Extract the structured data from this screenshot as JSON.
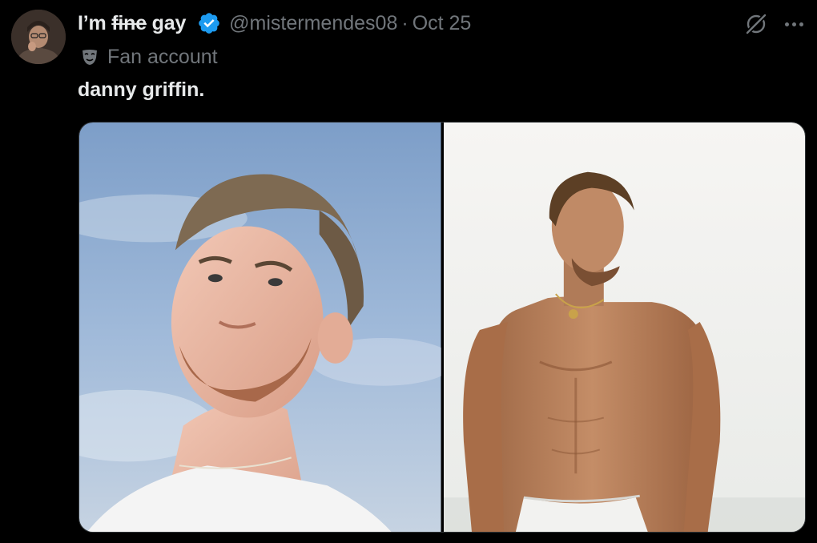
{
  "tweet": {
    "author": {
      "name_struck": "fine",
      "name_prefix": "I’m ",
      "name_suffix": " gay",
      "handle": "@mistermendes08",
      "verified": true
    },
    "separator": "·",
    "date": "Oct 25",
    "account_label": "Fan account",
    "text": "danny griffin.",
    "media": [
      {
        "icon": "photo-selfie",
        "description_color": "#8ea9cf"
      },
      {
        "icon": "photo-shirtless",
        "description_color": "#f1f0ee"
      }
    ]
  },
  "colors": {
    "background": "#000000",
    "text_primary": "#e7e9ea",
    "text_secondary": "#71767b",
    "verified_blue": "#1d9bf0",
    "border": "#2f3336"
  },
  "icons": {
    "verified": "verified-badge-icon",
    "grok": "grok-icon",
    "more": "more-icon",
    "label": "mask-icon"
  }
}
